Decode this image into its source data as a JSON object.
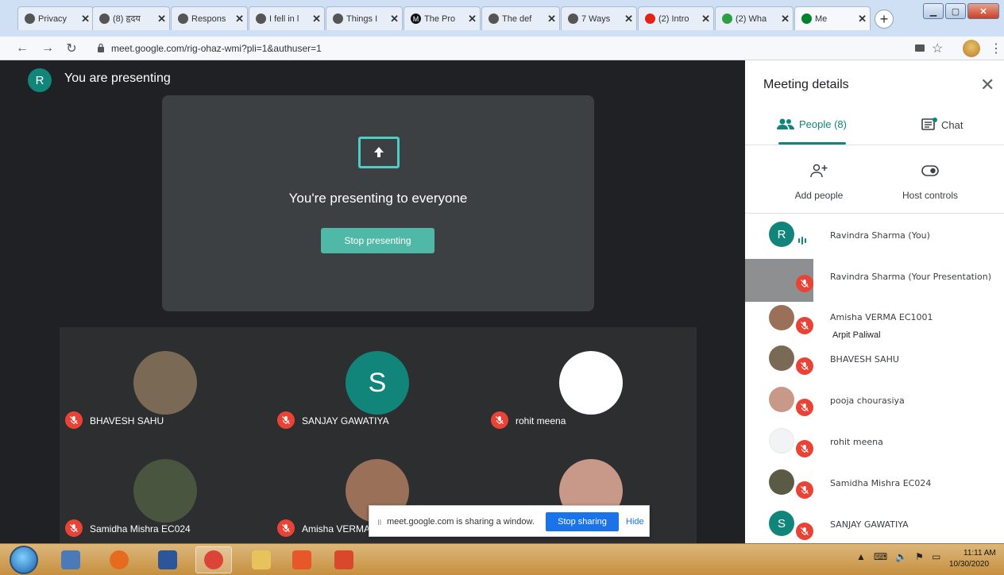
{
  "browser": {
    "tabs": [
      {
        "title": "Privacy",
        "favicon": "globe",
        "color": "#555555"
      },
      {
        "title": "(8) हृदय",
        "favicon": "globe",
        "color": "#555555"
      },
      {
        "title": "Respons",
        "favicon": "globe",
        "color": "#555555"
      },
      {
        "title": "I fell in l",
        "favicon": "globe",
        "color": "#555555"
      },
      {
        "title": "Things I",
        "favicon": "globe",
        "color": "#555555"
      },
      {
        "title": "The Pro",
        "favicon": "medium",
        "color": "#111111"
      },
      {
        "title": "The def",
        "favicon": "globe",
        "color": "#555555"
      },
      {
        "title": "7 Ways",
        "favicon": "globe",
        "color": "#555555"
      },
      {
        "title": "(2) Intro",
        "favicon": "youtube",
        "color": "#e62117"
      },
      {
        "title": "(2) Wha",
        "favicon": "quora-green",
        "color": "#2e9e44"
      },
      {
        "title": "Me",
        "favicon": "meet",
        "color": "#00832d"
      }
    ],
    "tab_close_glyph": "✕",
    "new_tab_glyph": "+",
    "url": "meet.google.com/rig-ohaz-wmi?pli=1&authuser=1"
  },
  "stage": {
    "presenter_initial": "R",
    "title": "You are presenting",
    "card_message": "You're presenting to everyone",
    "stop_presenting": "Stop presenting",
    "tiles": [
      {
        "name": "BHAVESH SAHU",
        "photo_color": "#7a6a55"
      },
      {
        "name": "SANJAY GAWATIYA",
        "initial": "S",
        "photo_color": "#12857a"
      },
      {
        "name": "rohit meena",
        "photo_color": "#ffffff"
      },
      {
        "name": "Samidha Mishra EC024",
        "photo_color": "#4a5540"
      },
      {
        "name": "Amisha VERMA",
        "photo_color": "#9a7058"
      },
      {
        "name": "",
        "photo_color": "#c89888"
      }
    ]
  },
  "share_bar": {
    "grip": "॥",
    "message": "meet.google.com is sharing a window.",
    "stop_sharing": "Stop sharing",
    "hide": "Hide"
  },
  "panel": {
    "title": "Meeting details",
    "close_glyph": "✕",
    "people_tab": "People (8)",
    "chat_tab": "Chat",
    "add_people": "Add people",
    "host_controls": "Host controls",
    "participants": [
      {
        "name": "Ravindra Sharma (You)",
        "initial": "R",
        "avatar_color": "#12857a",
        "muted": false
      },
      {
        "name": "Ravindra Sharma (Your Presentation)",
        "avatar_color": "#8d8f90",
        "muted": true
      },
      {
        "name": "Amisha VERMA EC1001",
        "avatar_color": "#9a7058",
        "muted": true
      },
      {
        "name": "BHAVESH SAHU",
        "avatar_color": "#7a6a55",
        "muted": true
      },
      {
        "name": "pooja chourasiya",
        "avatar_color": "#c89888",
        "muted": true
      },
      {
        "name": "rohit meena",
        "avatar_color": "#f1f3f4",
        "muted": true
      },
      {
        "name": "Samidha Mishra EC024",
        "avatar_color": "#5a5a45",
        "muted": true
      },
      {
        "name": "SANJAY GAWATIYA",
        "initial": "S",
        "avatar_color": "#12857a",
        "muted": true
      }
    ],
    "tooltip": "Arpit Paliwal"
  },
  "taskbar": {
    "apps": [
      "ie",
      "firefox",
      "word",
      "chrome",
      "explorer",
      "pdf",
      "recorder"
    ],
    "clock_time": "11:11 AM",
    "clock_date": "10/30/2020"
  },
  "colors": {
    "accent": "#12857a",
    "muted_red": "#ea4335",
    "share_blue": "#1a73e8"
  }
}
